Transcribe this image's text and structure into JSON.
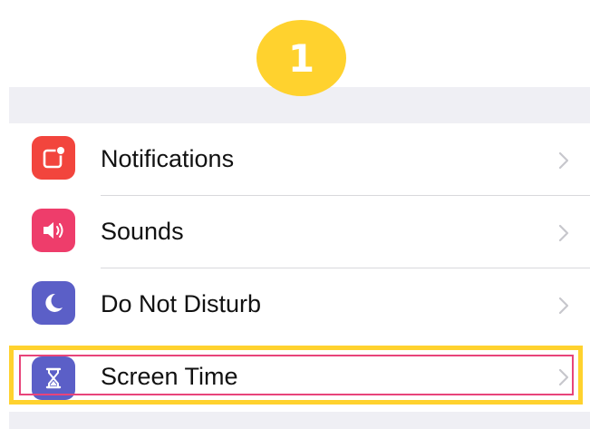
{
  "step_badge": {
    "number": "1",
    "color": "#ffd22e"
  },
  "settings": {
    "items": [
      {
        "label": "Notifications",
        "icon": "notifications-icon",
        "icon_color": "#f2453d"
      },
      {
        "label": "Sounds",
        "icon": "speaker-icon",
        "icon_color": "#ee3d6b"
      },
      {
        "label": "Do Not Disturb",
        "icon": "moon-icon",
        "icon_color": "#5b5fc7"
      },
      {
        "label": "Screen Time",
        "icon": "hourglass-icon",
        "icon_color": "#5b5fc7",
        "highlighted": true
      }
    ]
  },
  "highlight": {
    "outer_color": "#ffd22e",
    "inner_color": "#e8447a"
  }
}
